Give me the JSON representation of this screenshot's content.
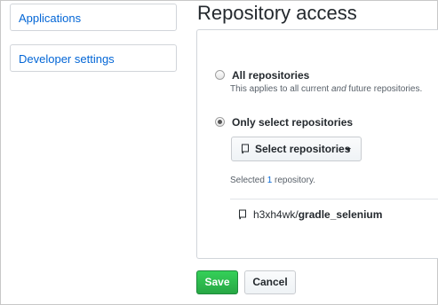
{
  "sidebar": {
    "items": [
      {
        "label": "Applications"
      },
      {
        "label": "Developer settings"
      }
    ]
  },
  "main": {
    "title": "Repository access",
    "options": [
      {
        "label": "All repositories",
        "description_before": "This applies to all current ",
        "description_em": "and",
        "description_after": " future repositories.",
        "checked": false
      },
      {
        "label": "Only select repositories",
        "checked": true
      }
    ],
    "select_button": {
      "label": "Select repositories",
      "icon": "repo-icon"
    },
    "selected_summary": {
      "prefix": "Selected ",
      "count": "1",
      "suffix": " repository."
    },
    "selected_repos": [
      {
        "owner": "h3xh4wk",
        "separator": "/",
        "name": "gradle_selenium",
        "icon": "repo-icon"
      }
    ]
  },
  "actions": {
    "save_label": "Save",
    "cancel_label": "Cancel"
  },
  "colors": {
    "link": "#0366d6",
    "primary_button": "#28a745",
    "border": "#d1d5da"
  }
}
